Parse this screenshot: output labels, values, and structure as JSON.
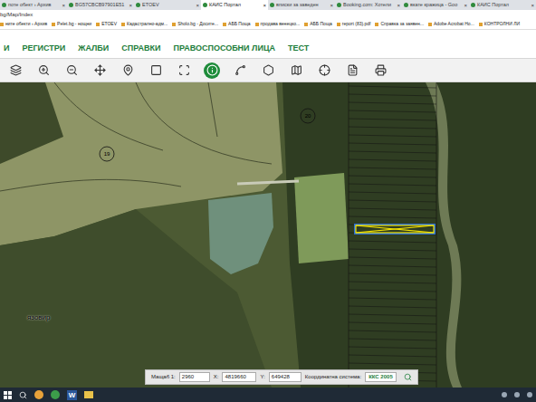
{
  "browser": {
    "tabs": [
      {
        "label": "поте обект › Архив",
        "selected": false
      },
      {
        "label": "BG57CBCB97901E51",
        "selected": false
      },
      {
        "label": "ETOEV",
        "selected": false
      },
      {
        "label": "КАИС Портал",
        "selected": true
      },
      {
        "label": "вписки за заведен",
        "selected": false
      },
      {
        "label": "Booking.com: Хотели",
        "selected": false
      },
      {
        "label": "вкате кражица - Goo",
        "selected": false
      },
      {
        "label": "КАИС Портал",
        "selected": false
      }
    ],
    "close": "×",
    "address": "bg/Map/Index",
    "bookmarks": [
      "ните обекти › Архив",
      "Pelet.bg - нощни",
      "ETOEV",
      "Кадастрално-адм...",
      "Sholo.bg - Досите...",
      "АББ Поща",
      "продава венецко...",
      "АББ Поща",
      "report (83).pdf",
      "Справка за заявен...",
      "Adobe Acrobat Ho...",
      "КОНТРОЛНИ ЛИ"
    ]
  },
  "menu": [
    "И",
    "РЕГИСТРИ",
    "ЖАЛБИ",
    "СПРАВКИ",
    "ПРАВОСПОСОБНИ ЛИЦА",
    "ТЕСТ"
  ],
  "toolbar": [
    {
      "selected": false
    },
    {
      "selected": false
    },
    {
      "selected": false
    },
    {
      "selected": false
    },
    {
      "selected": false
    },
    {
      "selected": false
    },
    {
      "selected": false
    },
    {
      "selected": true
    },
    {
      "selected": false
    },
    {
      "selected": false
    },
    {
      "selected": false
    },
    {
      "selected": false
    },
    {
      "selected": false
    },
    {
      "selected": false
    }
  ],
  "map": {
    "parcel_labels": [
      "19",
      "20"
    ],
    "water_label": "язовир"
  },
  "coordinates": {
    "scale_label": "Мащаб 1:",
    "scale": "2960",
    "x_label": "X:",
    "x": "4819660",
    "y_label": "Y:",
    "y": "649428",
    "system_label": "Координатна система:",
    "system": "ККС 2005"
  },
  "taskbar": {
    "word_label": "W"
  }
}
